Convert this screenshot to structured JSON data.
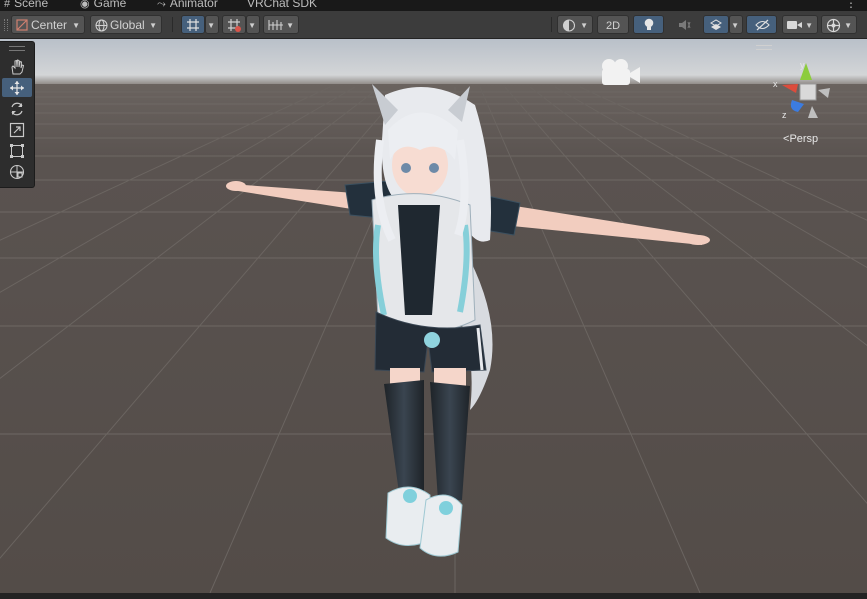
{
  "tabs": [
    {
      "label": "Scene",
      "icon": "grid-icon"
    },
    {
      "label": "Game",
      "icon": "gamepad-icon"
    },
    {
      "label": "Animator",
      "icon": "animator-icon"
    },
    {
      "label": "VRChat SDK",
      "icon": ""
    }
  ],
  "tab_menu": "⋮",
  "toolbar": {
    "pivot_label": "Center",
    "rotation_label": "Global",
    "mode_2d_label": "2D"
  },
  "gizmo": {
    "x_label": "x",
    "y_label": "y",
    "z_label": "z",
    "projection_label": "Persp"
  },
  "colors": {
    "x_axis": "#dc4c3c",
    "y_axis": "#8ccc3c",
    "z_axis": "#3c7ce0",
    "active": "#46607c",
    "floor": "#544d49",
    "sky": "#c8ced6"
  }
}
